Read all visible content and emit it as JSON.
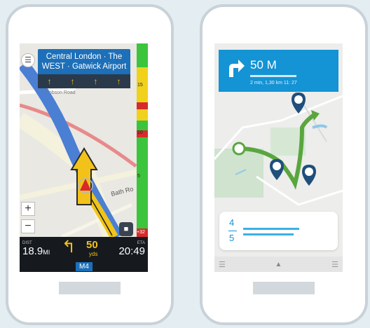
{
  "left_phone": {
    "route_banner": {
      "line1": "Central London · The",
      "line2": "WEST · Gatwick Airport"
    },
    "lanes": [
      "↑",
      "↑",
      "↑",
      "↑"
    ],
    "road_labels": {
      "minor": "Lobson Road",
      "bath": "Bath Ro"
    },
    "traffic_markers": [
      "15",
      "10",
      "5",
      "+32"
    ],
    "bottom_bar": {
      "dist_caption": "DIST",
      "dist_value": "18.9",
      "dist_unit": "MI",
      "turn_value": "50",
      "turn_unit": "yds",
      "eta_caption": "ETA",
      "eta_value": "20:49",
      "road_sign": "M4"
    }
  },
  "right_phone": {
    "nav_banner": {
      "distance": "50 M",
      "eta": "2 min, 1,30 km 11: 27"
    },
    "card": {
      "numerator": "4",
      "denominator": "5"
    },
    "accent_color": "#1493d5"
  }
}
